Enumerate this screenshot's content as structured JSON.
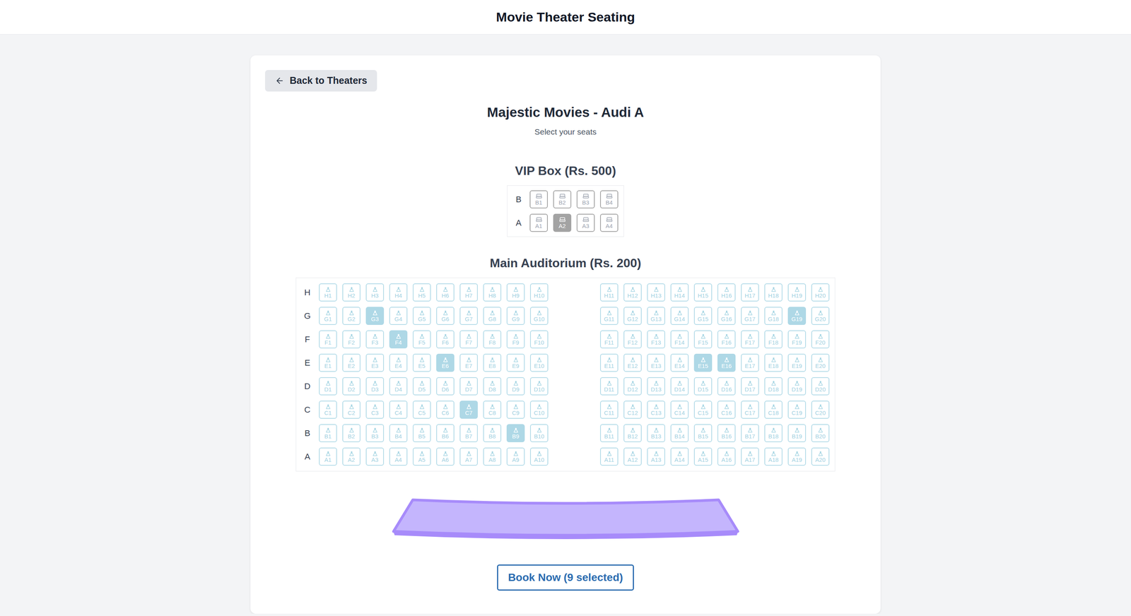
{
  "header": {
    "title": "Movie Theater Seating"
  },
  "back_button": {
    "label": "Back to Theaters"
  },
  "theater": {
    "title": "Majestic Movies - Audi A",
    "subtitle": "Select your seats"
  },
  "vip": {
    "title": "VIP Box (Rs. 500)",
    "rows": [
      {
        "label": "B",
        "seats": [
          {
            "label": "B1",
            "selected": false
          },
          {
            "label": "B2",
            "selected": false
          },
          {
            "label": "B3",
            "selected": false
          },
          {
            "label": "B4",
            "selected": false
          }
        ]
      },
      {
        "label": "A",
        "seats": [
          {
            "label": "A1",
            "selected": false
          },
          {
            "label": "A2",
            "selected": true
          },
          {
            "label": "A3",
            "selected": false
          },
          {
            "label": "A4",
            "selected": false
          }
        ]
      }
    ]
  },
  "main": {
    "title": "Main Auditorium (Rs. 200)",
    "rows": [
      {
        "label": "H",
        "seats": [
          {
            "label": "H1",
            "selected": false
          },
          {
            "label": "H2",
            "selected": false
          },
          {
            "label": "H3",
            "selected": false
          },
          {
            "label": "H4",
            "selected": false
          },
          {
            "label": "H5",
            "selected": false
          },
          {
            "label": "H6",
            "selected": false
          },
          {
            "label": "H7",
            "selected": false
          },
          {
            "label": "H8",
            "selected": false
          },
          {
            "label": "H9",
            "selected": false
          },
          {
            "label": "H10",
            "selected": false
          },
          {
            "label": "H11",
            "selected": false
          },
          {
            "label": "H12",
            "selected": false
          },
          {
            "label": "H13",
            "selected": false
          },
          {
            "label": "H14",
            "selected": false
          },
          {
            "label": "H15",
            "selected": false
          },
          {
            "label": "H16",
            "selected": false
          },
          {
            "label": "H17",
            "selected": false
          },
          {
            "label": "H18",
            "selected": false
          },
          {
            "label": "H19",
            "selected": false
          },
          {
            "label": "H20",
            "selected": false
          }
        ]
      },
      {
        "label": "G",
        "seats": [
          {
            "label": "G1",
            "selected": false
          },
          {
            "label": "G2",
            "selected": false
          },
          {
            "label": "G3",
            "selected": true
          },
          {
            "label": "G4",
            "selected": false
          },
          {
            "label": "G5",
            "selected": false
          },
          {
            "label": "G6",
            "selected": false
          },
          {
            "label": "G7",
            "selected": false
          },
          {
            "label": "G8",
            "selected": false
          },
          {
            "label": "G9",
            "selected": false
          },
          {
            "label": "G10",
            "selected": false
          },
          {
            "label": "G11",
            "selected": false
          },
          {
            "label": "G12",
            "selected": false
          },
          {
            "label": "G13",
            "selected": false
          },
          {
            "label": "G14",
            "selected": false
          },
          {
            "label": "G15",
            "selected": false
          },
          {
            "label": "G16",
            "selected": false
          },
          {
            "label": "G17",
            "selected": false
          },
          {
            "label": "G18",
            "selected": false
          },
          {
            "label": "G19",
            "selected": true
          },
          {
            "label": "G20",
            "selected": false
          }
        ]
      },
      {
        "label": "F",
        "seats": [
          {
            "label": "F1",
            "selected": false
          },
          {
            "label": "F2",
            "selected": false
          },
          {
            "label": "F3",
            "selected": false
          },
          {
            "label": "F4",
            "selected": true
          },
          {
            "label": "F5",
            "selected": false
          },
          {
            "label": "F6",
            "selected": false
          },
          {
            "label": "F7",
            "selected": false
          },
          {
            "label": "F8",
            "selected": false
          },
          {
            "label": "F9",
            "selected": false
          },
          {
            "label": "F10",
            "selected": false
          },
          {
            "label": "F11",
            "selected": false
          },
          {
            "label": "F12",
            "selected": false
          },
          {
            "label": "F13",
            "selected": false
          },
          {
            "label": "F14",
            "selected": false
          },
          {
            "label": "F15",
            "selected": false
          },
          {
            "label": "F16",
            "selected": false
          },
          {
            "label": "F17",
            "selected": false
          },
          {
            "label": "F18",
            "selected": false
          },
          {
            "label": "F19",
            "selected": false
          },
          {
            "label": "F20",
            "selected": false
          }
        ]
      },
      {
        "label": "E",
        "seats": [
          {
            "label": "E1",
            "selected": false
          },
          {
            "label": "E2",
            "selected": false
          },
          {
            "label": "E3",
            "selected": false
          },
          {
            "label": "E4",
            "selected": false
          },
          {
            "label": "E5",
            "selected": false
          },
          {
            "label": "E6",
            "selected": true
          },
          {
            "label": "E7",
            "selected": false
          },
          {
            "label": "E8",
            "selected": false
          },
          {
            "label": "E9",
            "selected": false
          },
          {
            "label": "E10",
            "selected": false
          },
          {
            "label": "E11",
            "selected": false
          },
          {
            "label": "E12",
            "selected": false
          },
          {
            "label": "E13",
            "selected": false
          },
          {
            "label": "E14",
            "selected": false
          },
          {
            "label": "E15",
            "selected": true
          },
          {
            "label": "E16",
            "selected": true
          },
          {
            "label": "E17",
            "selected": false
          },
          {
            "label": "E18",
            "selected": false
          },
          {
            "label": "E19",
            "selected": false
          },
          {
            "label": "E20",
            "selected": false
          }
        ]
      },
      {
        "label": "D",
        "seats": [
          {
            "label": "D1",
            "selected": false
          },
          {
            "label": "D2",
            "selected": false
          },
          {
            "label": "D3",
            "selected": false
          },
          {
            "label": "D4",
            "selected": false
          },
          {
            "label": "D5",
            "selected": false
          },
          {
            "label": "D6",
            "selected": false
          },
          {
            "label": "D7",
            "selected": false
          },
          {
            "label": "D8",
            "selected": false
          },
          {
            "label": "D9",
            "selected": false
          },
          {
            "label": "D10",
            "selected": false
          },
          {
            "label": "D11",
            "selected": false
          },
          {
            "label": "D12",
            "selected": false
          },
          {
            "label": "D13",
            "selected": false
          },
          {
            "label": "D14",
            "selected": false
          },
          {
            "label": "D15",
            "selected": false
          },
          {
            "label": "D16",
            "selected": false
          },
          {
            "label": "D17",
            "selected": false
          },
          {
            "label": "D18",
            "selected": false
          },
          {
            "label": "D19",
            "selected": false
          },
          {
            "label": "D20",
            "selected": false
          }
        ]
      },
      {
        "label": "C",
        "seats": [
          {
            "label": "C1",
            "selected": false
          },
          {
            "label": "C2",
            "selected": false
          },
          {
            "label": "C3",
            "selected": false
          },
          {
            "label": "C4",
            "selected": false
          },
          {
            "label": "C5",
            "selected": false
          },
          {
            "label": "C6",
            "selected": false
          },
          {
            "label": "C7",
            "selected": true
          },
          {
            "label": "C8",
            "selected": false
          },
          {
            "label": "C9",
            "selected": false
          },
          {
            "label": "C10",
            "selected": false
          },
          {
            "label": "C11",
            "selected": false
          },
          {
            "label": "C12",
            "selected": false
          },
          {
            "label": "C13",
            "selected": false
          },
          {
            "label": "C14",
            "selected": false
          },
          {
            "label": "C15",
            "selected": false
          },
          {
            "label": "C16",
            "selected": false
          },
          {
            "label": "C17",
            "selected": false
          },
          {
            "label": "C18",
            "selected": false
          },
          {
            "label": "C19",
            "selected": false
          },
          {
            "label": "C20",
            "selected": false
          }
        ]
      },
      {
        "label": "B",
        "seats": [
          {
            "label": "B1",
            "selected": false
          },
          {
            "label": "B2",
            "selected": false
          },
          {
            "label": "B3",
            "selected": false
          },
          {
            "label": "B4",
            "selected": false
          },
          {
            "label": "B5",
            "selected": false
          },
          {
            "label": "B6",
            "selected": false
          },
          {
            "label": "B7",
            "selected": false
          },
          {
            "label": "B8",
            "selected": false
          },
          {
            "label": "B9",
            "selected": true
          },
          {
            "label": "B10",
            "selected": false
          },
          {
            "label": "B11",
            "selected": false
          },
          {
            "label": "B12",
            "selected": false
          },
          {
            "label": "B13",
            "selected": false
          },
          {
            "label": "B14",
            "selected": false
          },
          {
            "label": "B15",
            "selected": false
          },
          {
            "label": "B16",
            "selected": false
          },
          {
            "label": "B17",
            "selected": false
          },
          {
            "label": "B18",
            "selected": false
          },
          {
            "label": "B19",
            "selected": false
          },
          {
            "label": "B20",
            "selected": false
          }
        ]
      },
      {
        "label": "A",
        "seats": [
          {
            "label": "A1",
            "selected": false
          },
          {
            "label": "A2",
            "selected": false
          },
          {
            "label": "A3",
            "selected": false
          },
          {
            "label": "A4",
            "selected": false
          },
          {
            "label": "A5",
            "selected": false
          },
          {
            "label": "A6",
            "selected": false
          },
          {
            "label": "A7",
            "selected": false
          },
          {
            "label": "A8",
            "selected": false
          },
          {
            "label": "A9",
            "selected": false
          },
          {
            "label": "A10",
            "selected": false
          },
          {
            "label": "A11",
            "selected": false
          },
          {
            "label": "A12",
            "selected": false
          },
          {
            "label": "A13",
            "selected": false
          },
          {
            "label": "A14",
            "selected": false
          },
          {
            "label": "A15",
            "selected": false
          },
          {
            "label": "A16",
            "selected": false
          },
          {
            "label": "A17",
            "selected": false
          },
          {
            "label": "A18",
            "selected": false
          },
          {
            "label": "A19",
            "selected": false
          },
          {
            "label": "A20",
            "selected": false
          }
        ]
      }
    ]
  },
  "book_button": {
    "label": "Book Now (9 selected)"
  }
}
